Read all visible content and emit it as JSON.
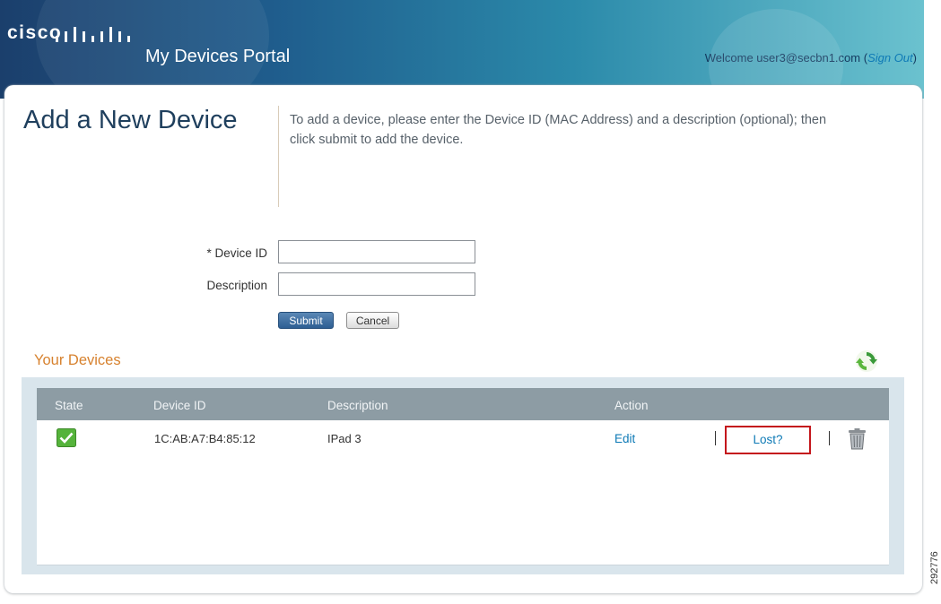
{
  "header": {
    "logo_text": "cisco",
    "portal_title": "My Devices Portal",
    "welcome_text": "Welcome user3@secbn1.com",
    "open_paren": " (",
    "sign_out_label": "Sign Out",
    "close_paren": ")"
  },
  "form": {
    "heading": "Add a New Device",
    "instructions": "To add a device, please enter the Device ID (MAC Address) and a description (optional); then click submit to add the device.",
    "device_id_label": "* Device ID",
    "device_id_value": "",
    "description_label": "Description",
    "description_value": "",
    "submit_label": "Submit",
    "cancel_label": "Cancel"
  },
  "devices": {
    "section_title": "Your Devices",
    "refresh_icon": "refresh-icon",
    "columns": [
      "State",
      "Device ID",
      "Description",
      "Action"
    ],
    "rows": [
      {
        "state_icon": "checkmark-icon",
        "device_id": "1C:AB:A7:B4:85:12",
        "description": "IPad 3",
        "edit_label": "Edit",
        "lost_label": "Lost?",
        "delete_icon": "trash-icon"
      }
    ]
  },
  "figure_id": "292776",
  "colors": {
    "accent": "#0e7ab6",
    "section_title": "#d7822f",
    "heading": "#1f3f5d",
    "highlight_border": "#c4161c",
    "table_header": "#8d9ca4"
  }
}
